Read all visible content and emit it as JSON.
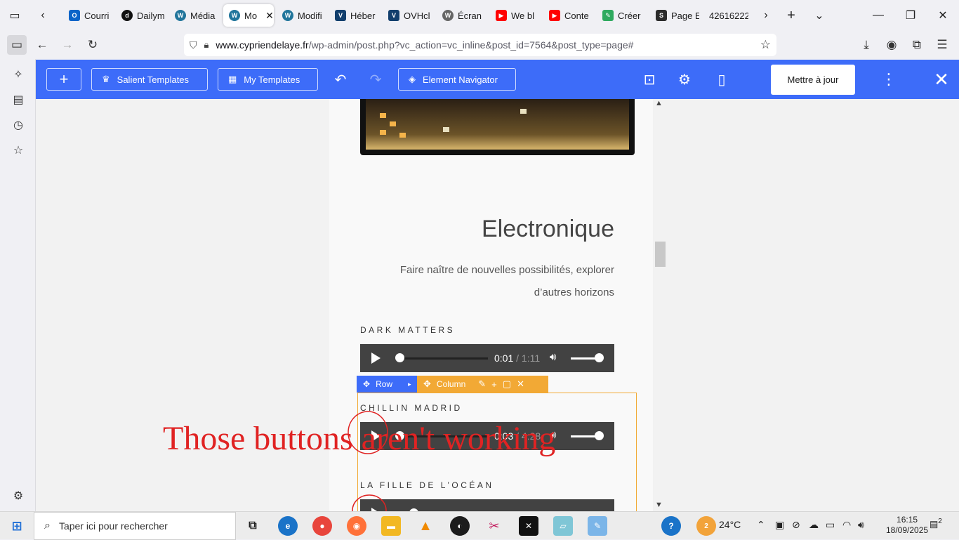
{
  "tabs": [
    {
      "label": "Courri",
      "icon": "outlook-icon",
      "color": "#0a64c8"
    },
    {
      "label": "Dailym",
      "icon": "dailymotion-icon",
      "color": "#111111"
    },
    {
      "label": "Média",
      "icon": "wordpress-icon",
      "color": "#21759b"
    },
    {
      "label": "Mo",
      "icon": "wordpress-icon",
      "color": "#21759b",
      "active": true
    },
    {
      "label": "Modifi",
      "icon": "wordpress-icon",
      "color": "#21759b"
    },
    {
      "label": "Héber",
      "icon": "ovh-icon",
      "color": "#123f6d"
    },
    {
      "label": "OVHcl",
      "icon": "ovh-icon",
      "color": "#123f6d"
    },
    {
      "label": "Écran",
      "icon": "wordpress-icon",
      "color": "#666666"
    },
    {
      "label": "We bl",
      "icon": "youtube-icon",
      "color": "#ff0000"
    },
    {
      "label": "Conte",
      "icon": "youtube-icon",
      "color": "#ff0000"
    },
    {
      "label": "Créer",
      "icon": "edit-icon",
      "color": "#2faa5f"
    },
    {
      "label": "Page E",
      "icon": "salient-icon",
      "color": "#2b2b2b"
    },
    {
      "label": "42616222",
      "icon": "",
      "color": "#888888"
    }
  ],
  "url": {
    "host": "www.cypriendelaye.fr",
    "path": "/wp-admin/post.php?vc_action=vc_inline&post_id=7564&post_type=page#"
  },
  "toolbar": {
    "salient_templates": "Salient Templates",
    "my_templates": "My Templates",
    "element_navigator": "Element Navigator",
    "update": "Mettre à jour"
  },
  "page": {
    "heading": "Electronique",
    "subtitle": "Faire naître de nouvelles possibilités, explorer d’autres horizons",
    "tracks": [
      {
        "title": "DARK MATTERS",
        "current": "0:01",
        "duration": "1:11"
      },
      {
        "title": "CHILLIN MADRID",
        "current": "0:03",
        "duration": "4:28"
      },
      {
        "title": "LA FILLE DE L’OCÉAN",
        "current": "",
        "duration": ""
      }
    ],
    "row_label": "Row",
    "column_label": "Column"
  },
  "annotation": "Those buttons aren't working",
  "taskbar": {
    "search_placeholder": "Taper ici pour rechercher",
    "weather": "24°C",
    "weather_badge": "2",
    "time": "16:15",
    "date": "18/09/2025",
    "notifications": "2"
  },
  "colors": {
    "accent": "#3d6cf9",
    "column_orange": "#f2a935",
    "annotation_red": "#e02323"
  }
}
